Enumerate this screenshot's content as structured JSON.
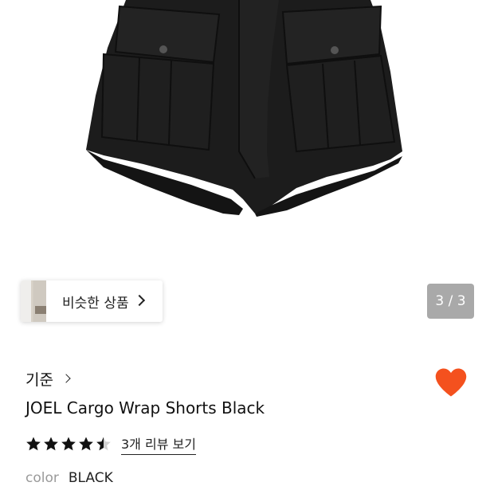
{
  "similar": {
    "label": "비슷한 상품"
  },
  "gallery": {
    "counter": "3 / 3"
  },
  "product": {
    "brand": "기준",
    "title": "JOEL Cargo Wrap Shorts Black",
    "rating": 4.5,
    "reviews_label": "3개 리뷰 보기",
    "color_key": "color",
    "color_value": "BLACK",
    "wishlist_color": "#f4511e"
  }
}
